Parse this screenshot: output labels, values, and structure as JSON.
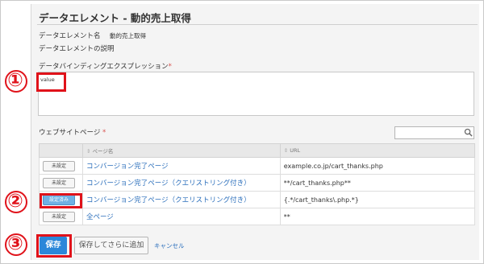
{
  "form": {
    "title": "データエレメント - 動的売上取得",
    "name_label": "データエレメント名",
    "name_value": "動的売上取得",
    "description_label": "データエレメントの説明",
    "expression_label": "データバインディングエクスプレッション",
    "required_mark": "*",
    "expression_value": "value",
    "website_label": "ウェブサイトページ",
    "search_placeholder": ""
  },
  "table": {
    "headers": [
      "",
      "ページ名",
      "URL"
    ],
    "rows": [
      {
        "button": "未設定",
        "active": false,
        "page": "コンバージョン完了ページ",
        "url": "example.co.jp/cart_thanks.php"
      },
      {
        "button": "未設定",
        "active": false,
        "page": "コンバージョン完了ページ（クエリストリング付き）",
        "url": "**/cart_thanks.php**"
      },
      {
        "button": "設定済み",
        "active": true,
        "page": "コンバージョン完了ページ（クエリストリング付き）",
        "url": "{.*/cart_thanks\\.php.*}"
      },
      {
        "button": "未設定",
        "active": false,
        "page": "全ページ",
        "url": "**"
      }
    ]
  },
  "actions": {
    "save_label": "保存",
    "save_add_label": "保存してさらに追加",
    "cancel_label": "キャンセル"
  },
  "annotations": [
    "①",
    "②",
    "③"
  ],
  "colors": {
    "accent": "#2b87d9",
    "annotation": "#e0121a",
    "link": "#2a6ebb"
  },
  "icons": {
    "search": "search-icon",
    "sort": "sort-icon"
  }
}
